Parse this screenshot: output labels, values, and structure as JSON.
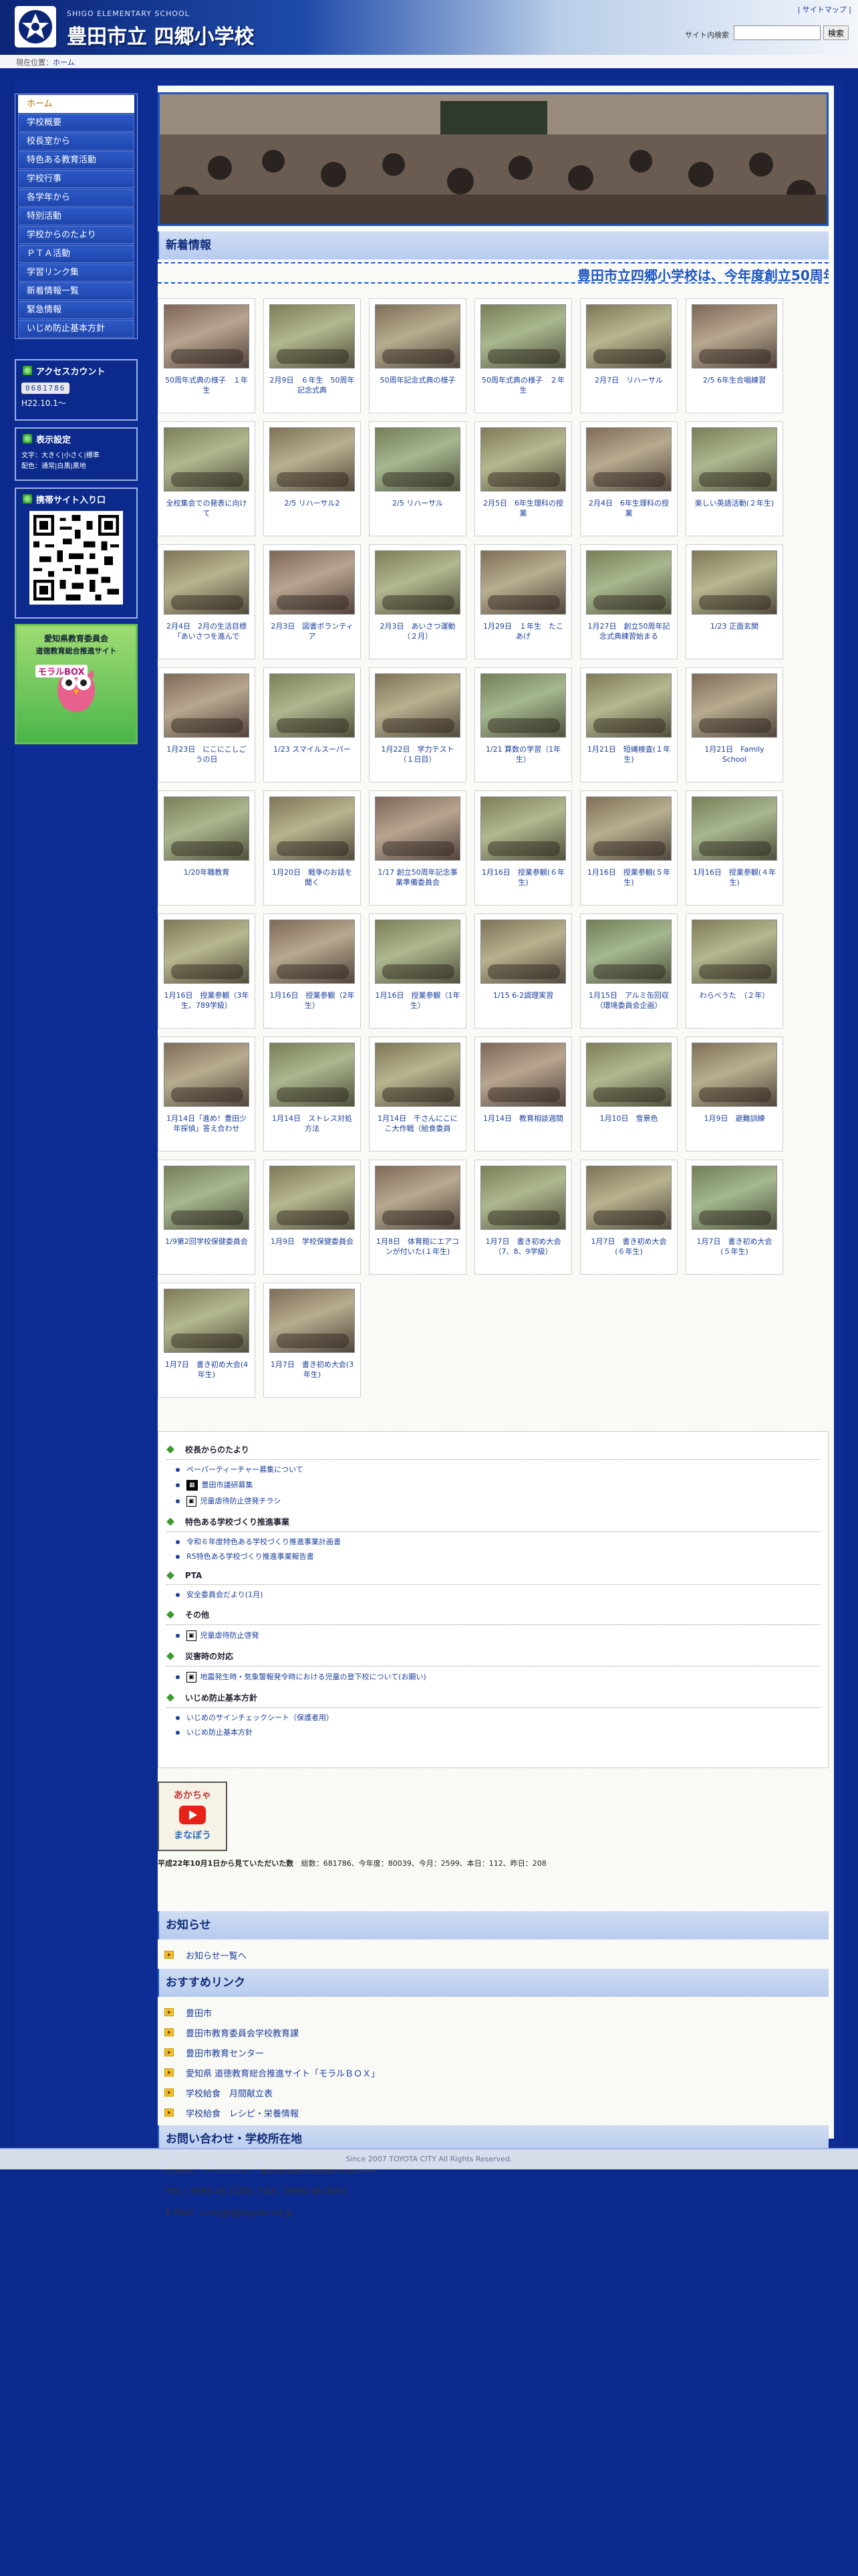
{
  "header": {
    "school_en": "SHIGO ELEMENTARY SCHOOL",
    "school_name": "豊田市立 四郷小学校",
    "sitemap": "| サイトマップ |",
    "search_label": "サイト内検索",
    "search_value": "",
    "search_button": "検索"
  },
  "breadcrumb": {
    "label": "現在位置：",
    "current": "ホーム"
  },
  "sidebar": {
    "menu": [
      "ホーム",
      "学校概要",
      "校長室から",
      "特色ある教育活動",
      "学校行事",
      "各学年から",
      "特別活動",
      "学校からのたより",
      "ＰＴＡ活動",
      "学習リンク集",
      "新着情報一覧",
      "緊急情報",
      "いじめ防止基本方針"
    ],
    "access_title": "アクセスカウント",
    "counter": "0681786",
    "since": "H22.10.1〜",
    "display_title": "表示設定",
    "text_line": "文字：大きく|小さく|標準",
    "color_line": "配色：通常|白黒|黒地",
    "mobile_title": "携帯サイト入り口",
    "banner_line1": "愛知県教育委員会",
    "banner_line2": "道徳教育総合推進サイト",
    "banner_brand": "モラルBOX"
  },
  "news": {
    "header": "新着情報",
    "marquee": "豊田市立四郷小学校は、今年度創立50周年",
    "items": [
      "50周年式典の様子　１年生",
      "2月9日　６年生　50周年記念式典",
      "50周年記念式典の様子",
      "50周年式典の様子　２年生",
      "2月7日　リハーサル",
      "2/5 6年生合唱練習",
      "全校集会での発表に向けて",
      "2/5 リハーサル2",
      "2/5 リハーサル",
      "2月5日　6年生理科の授業",
      "2月4日　6年生理科の授業",
      "楽しい英語活動(２年生)",
      "2月4日　2月の生活目標「あいさつを進んで",
      "2月3日　図書ボランティア",
      "2月3日　あいさつ運動（２月）",
      "1月29日　１年生　たこあげ",
      "1月27日　創立50周年記念式典練習始まる",
      "1/23 正面玄関",
      "1月23日　にこにこしごうの日",
      "1/23 スマイルスーパー",
      "1月22日　学力テスト（１日目）",
      "1/21 算数の学習（1年生）",
      "1月21日　短縄検査(１年生)",
      "1月21日　Family School",
      "1/20年職教育",
      "1月20日　戦争のお話を聞く",
      "1/17 創立50周年記念事業準備委員会",
      "1月16日　授業参観(６年生)",
      "1月16日　授業参観(５年生)",
      "1月16日　授業参観(４年生)",
      "1月16日　授業参観（3年生、789学級）",
      "1月16日　授業参観（2年生）",
      "1月16日　授業参観（1年生）",
      "1/15 6-2調理実習",
      "1月15日　アルミ缶回収（環境委員会企画）",
      "わらべうた　（２年）",
      "1月14日「進め！豊田少年探偵」答え合わせ",
      "1月14日　ストレス対処方法",
      "1月14日　千さんにこにこ大作戦（給食委員",
      "1月14日　教育相談週間",
      "1月10日　雪景色",
      "1月9日　避難訓練",
      "1/9第2回学校保健委員会",
      "1月9日　学校保健委員会",
      "1月8日　体育館にエアコンが付いた(１年生)",
      "1月7日　書き初め大会（7、8、9学級）",
      "1月7日　書き初め大会(６年生)",
      "1月7日　書き初め大会(５年生)",
      "1月7日　書き初め大会(4年生)",
      "1月7日　書き初め大会(3年生)"
    ]
  },
  "links": {
    "sections": [
      {
        "title": "校長からのたより",
        "items": [
          {
            "tag": "",
            "text": "ペーパーティーチャー募集について"
          },
          {
            "tag": "pdf",
            "text": "豊田市議研募集"
          },
          {
            "tag": "new",
            "text": "児童虐待防止啓発チラシ"
          }
        ]
      },
      {
        "title": "特色ある学校づくり推進事業",
        "items": [
          {
            "tag": "",
            "text": "令和６年度特色ある学校づくり推進事業計画書"
          },
          {
            "tag": "",
            "text": "R5特色ある学校づくり推進事業報告書"
          }
        ]
      },
      {
        "title": "PTA",
        "items": [
          {
            "tag": "",
            "text": "安全委員会だより(1月)"
          }
        ]
      },
      {
        "title": "その他",
        "items": [
          {
            "tag": "new",
            "text": "児童虐待防止啓発"
          }
        ]
      },
      {
        "title": "災害時の対応",
        "items": [
          {
            "tag": "new",
            "text": "地震発生時・気象警報発令時における児童の登下校について(お願い)"
          }
        ]
      },
      {
        "title": "いじめ防止基本方針",
        "items": [
          {
            "tag": "",
            "text": "いじめのサインチェックシート（保護者用）"
          },
          {
            "tag": "",
            "text": "いじめ防止基本方針"
          }
        ]
      }
    ]
  },
  "video": {
    "line1": "あかちゃ",
    "line2": "まなぼう"
  },
  "visits": {
    "text": "平成22年10月1日から見ていただいた数",
    "stats": "総数：681786、今年度：80039、今月：2599、本日：112、昨日：208"
  },
  "notice": {
    "header": "お知らせ",
    "link": "お知らせ一覧へ"
  },
  "recommend": {
    "header": "おすすめリンク",
    "items": [
      "豊田市",
      "豊田市教育委員会学校教育課",
      "豊田市教育センター",
      "愛知県 道徳教育総合推進サイト「モラルＢＯＸ」",
      "学校給食　月間献立表",
      "学校給食　レシピ・栄養情報"
    ]
  },
  "contact": {
    "header": "お問い合わせ・学校所在地",
    "address": "所在地：〒470-0373　愛知県豊田市四郷町山畑76-8",
    "tel": "TEL：0565-45-2283／FAX：0565-46-0693",
    "email": "E-Mail：s-shigo@toyota.ed.jp"
  },
  "footer": {
    "copyright": "Since 2007 TOYOTA CITY All Rights Reserved."
  },
  "colors": {
    "brand": "#0b2a8c",
    "accent": "#1d56c4",
    "header_band": "#b8cbee"
  }
}
